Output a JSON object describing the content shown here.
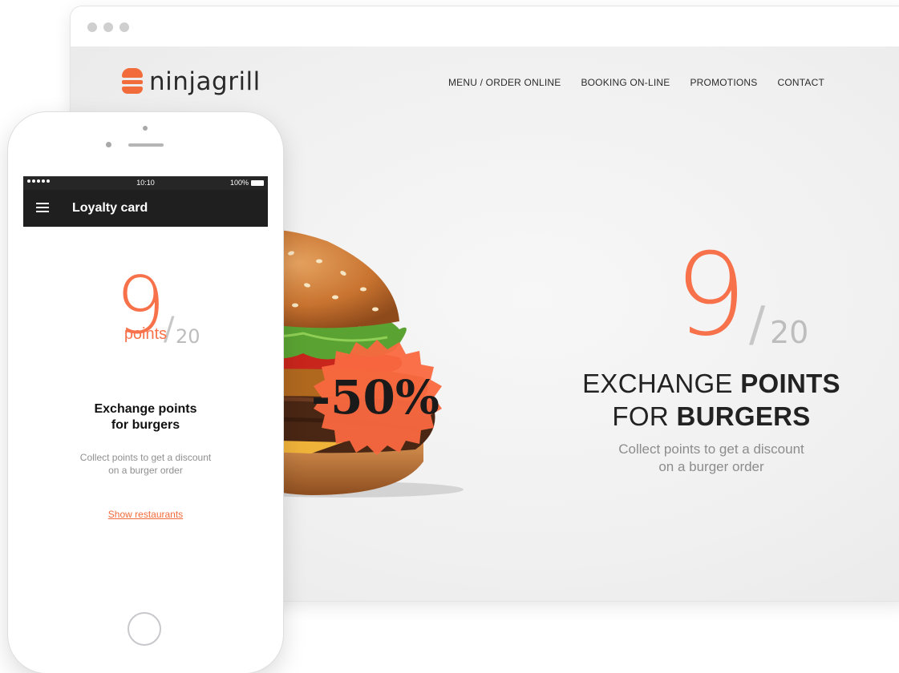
{
  "site": {
    "logo_text": "ninjagrill",
    "nav": [
      {
        "label": "MENU / ORDER ONLINE"
      },
      {
        "label": "BOOKING ON-LINE"
      },
      {
        "label": "PROMOTIONS"
      },
      {
        "label": "CONTACT"
      }
    ],
    "hero": {
      "points": "9",
      "slash": "/",
      "total": "20",
      "title_light_1": "EXCHANGE ",
      "title_bold_1": "POINTS",
      "title_light_2": "FOR ",
      "title_bold_2": "BURGERS",
      "subtitle_line1": "Collect points to get a discount",
      "subtitle_line2": "on a burger order"
    },
    "badge_text": "-50%"
  },
  "phone": {
    "status": {
      "time": "10:10",
      "battery": "100%"
    },
    "appbar_title": "Loyalty card",
    "card": {
      "points": "9",
      "slash": "/",
      "total": "20",
      "points_label": "points",
      "title_line1": "Exchange points",
      "title_line2": "for burgers",
      "subtitle_line1": "Collect points to get a discount",
      "subtitle_line2": "on a burger order",
      "link": "Show restaurants"
    }
  },
  "colors": {
    "accent": "#f7714a",
    "dark_bar": "#1f1f1f",
    "text_dark": "#222222",
    "text_muted": "#8c8c8c"
  }
}
